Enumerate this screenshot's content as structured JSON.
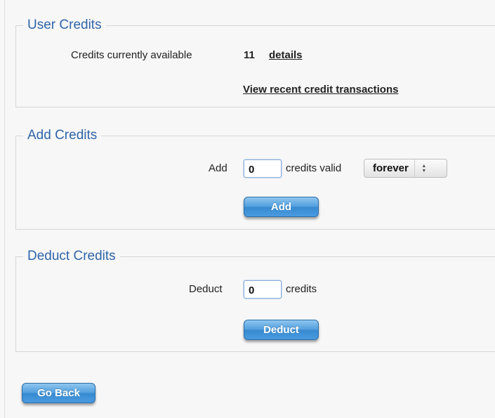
{
  "user_credits": {
    "legend": "User Credits",
    "available_label": "Credits currently available",
    "available_value": "11",
    "details_link": "details",
    "transactions_link": "View recent credit transactions"
  },
  "add_credits": {
    "legend": "Add Credits",
    "add_label": "Add",
    "amount_value": "0",
    "valid_label": "credits valid",
    "validity_selected": "forever",
    "button_label": "Add"
  },
  "deduct_credits": {
    "legend": "Deduct Credits",
    "deduct_label": "Deduct",
    "amount_value": "0",
    "credits_label": "credits",
    "button_label": "Deduct"
  },
  "go_back_label": "Go Back",
  "colors": {
    "legend": "#2f64a8",
    "button": "#3789cf"
  }
}
